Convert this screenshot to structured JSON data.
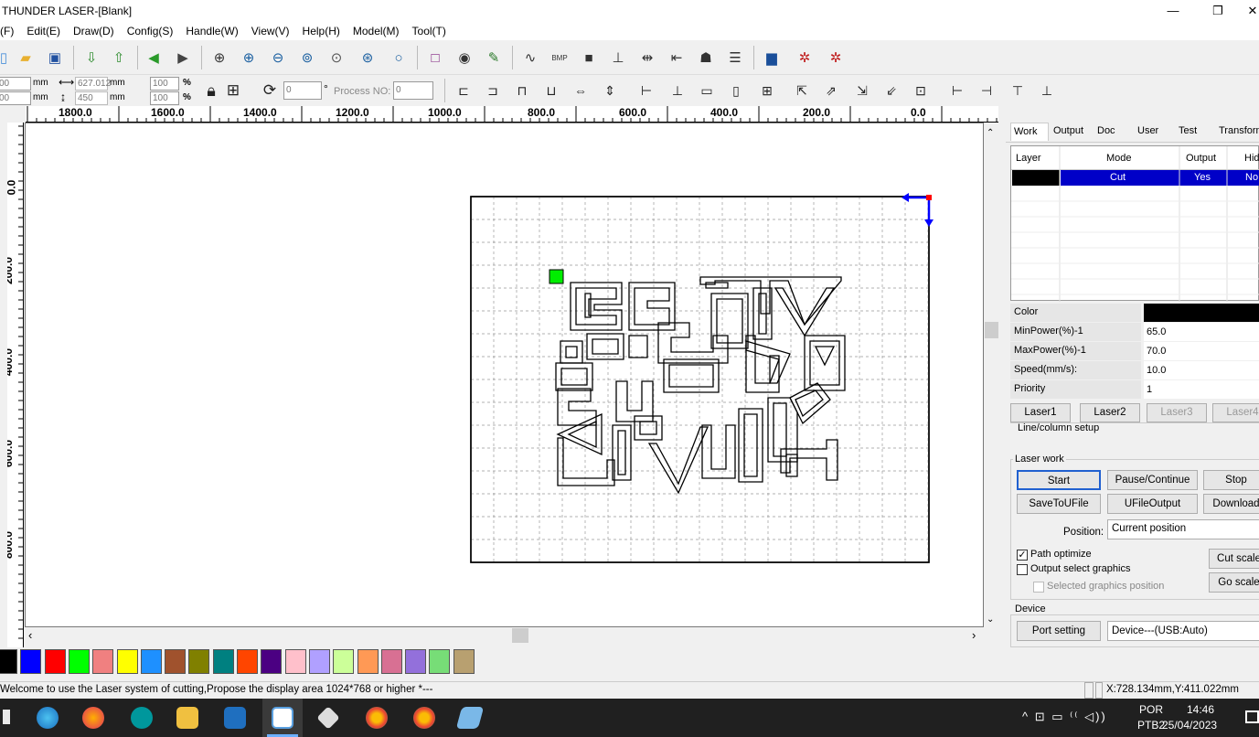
{
  "window": {
    "title": "THUNDER LASER-[Blank]",
    "min": "—",
    "restore": "❐",
    "close": "✕"
  },
  "menu": [
    "(F)",
    "Edit(E)",
    "Draw(D)",
    "Config(S)",
    "Handle(W)",
    "View(V)",
    "Help(H)",
    "Model(M)",
    "Tool(T)"
  ],
  "toolbar2": {
    "x_pos": "00",
    "y_pos": "00",
    "unit1": "mm",
    "unit2": "mm",
    "width": "627.012",
    "height": "450",
    "wunit": "mm",
    "hunit": "mm",
    "sx": "100",
    "sy": "100",
    "pct1": "%",
    "pct2": "%",
    "angle": "0",
    "deg": "°",
    "process_label": "Process NO:",
    "process_value": "0"
  },
  "ruler": {
    "h": [
      "1800.0",
      "1600.0",
      "1400.0",
      "1200.0",
      "1000.0",
      "800.0",
      "600.0",
      "400.0",
      "200.0",
      "0.0"
    ],
    "v": [
      "0.0",
      "200.0",
      "400.0",
      "600.0",
      "800.0"
    ]
  },
  "panel": {
    "tabs": [
      "Work",
      "Output",
      "Doc",
      "User",
      "Test",
      "Transform"
    ],
    "table_headers": [
      "Layer",
      "Mode",
      "Output",
      "Hide"
    ],
    "layer_row": {
      "mode": "Cut",
      "output": "Yes",
      "hide": "No"
    },
    "properties": [
      {
        "key": "Color",
        "value": ""
      },
      {
        "key": "MinPower(%)-1",
        "value": "65.0"
      },
      {
        "key": "MaxPower(%)-1",
        "value": "70.0"
      },
      {
        "key": "Speed(mm/s):",
        "value": "10.0"
      },
      {
        "key": "Priority",
        "value": "1"
      }
    ],
    "laser_tabs": [
      "Laser1",
      "Laser2",
      "Laser3",
      "Laser4"
    ],
    "line_setup": "Line/column setup",
    "laser_work": {
      "group_label": "Laser work",
      "start": "Start",
      "pause": "Pause/Continue",
      "stop": "Stop",
      "save_ufile": "SaveToUFile",
      "ufile_output": "UFileOutput",
      "download": "Download",
      "position_label": "Position:",
      "position_value": "Current position",
      "path_optimize": "Path optimize",
      "output_select": "Output select graphics",
      "selected_pos": "Selected graphics position",
      "cut_scale": "Cut scale",
      "go_scale": "Go scale"
    },
    "device": {
      "group_label": "Device",
      "port_setting": "Port setting",
      "device_value": "Device---(USB:Auto)"
    }
  },
  "palette": [
    "#000000",
    "#0000ff",
    "#ff0000",
    "#00ff00",
    "#f08080",
    "#ffff00",
    "#1e90ff",
    "#a0522d",
    "#808000",
    "#008080",
    "#ff4500",
    "#4b0082",
    "#ffc0cb",
    "#b0a0ff",
    "#ccff99",
    "#ff9955",
    "#d87093",
    "#9370db",
    "#77dd77",
    "#b8a070"
  ],
  "status": {
    "message": "Welcome to use the Laser system of cutting,Propose the display area 1024*768 or higher *---",
    "coords": "X:728.134mm,Y:411.022mm"
  },
  "taskbar": {
    "lang": "POR",
    "layout": "PTB2",
    "time": "14:46",
    "date": "25/04/2023",
    "tray": "^  ⊡  ▭  ⁽⁽  ◁))"
  },
  "colors": {
    "selection": "#0000c8",
    "accent": "#2060d0"
  }
}
